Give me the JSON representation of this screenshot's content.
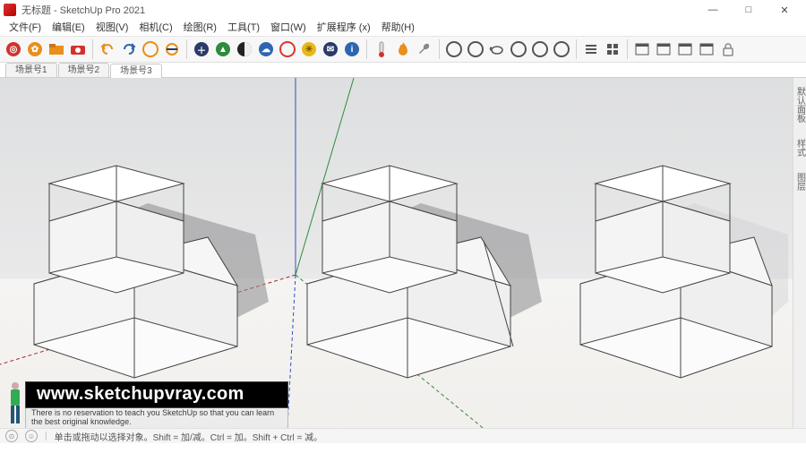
{
  "window": {
    "title": "无标题 - SketchUp Pro 2021",
    "min": "—",
    "max": "□",
    "close": "✕"
  },
  "menu": {
    "file": {
      "full": "文件(F)",
      "u": "F"
    },
    "edit": {
      "full": "编辑(E)",
      "u": "E"
    },
    "view": {
      "full": "视图(V)",
      "u": "V"
    },
    "camera": {
      "full": "相机(C)",
      "u": "C"
    },
    "draw": {
      "full": "绘图(R)",
      "u": "R"
    },
    "tools": {
      "full": "工具(T)",
      "u": "T"
    },
    "window": {
      "full": "窗口(W)",
      "u": "W"
    },
    "ext": {
      "full": "扩展程序 (x)",
      "u": "x"
    },
    "help": {
      "full": "帮助(H)",
      "u": "H"
    }
  },
  "scene_tabs": [
    "场景号1",
    "场景号2",
    "场景号3"
  ],
  "active_scene_index": 2,
  "side_tabs": [
    "默认面板",
    "样式",
    "图层"
  ],
  "watermark": {
    "url": "www.sketchupvray.com",
    "sub": "There is no reservation to teach you SketchUp so that you can learn the best original knowledge."
  },
  "status": {
    "hint": "单击或拖动以选择对象。Shift = 加/减。Ctrl = 加。Shift + Ctrl = 减。"
  },
  "icons": {
    "target": "target-icon",
    "gear": "gear-icon",
    "folder": "folder-icon",
    "camera": "camera-icon",
    "undo": "undo-icon",
    "redo": "redo-icon",
    "ring1": "ring-icon",
    "ringbar": "ring-icon",
    "plus": "plus-icon",
    "tree": "tree-icon",
    "checker": "checker-icon",
    "cloud": "cloud-icon",
    "refresh": "refresh-icon",
    "sun": "sun-icon",
    "mail": "mail-icon",
    "info": "info-icon",
    "thermo": "thermo-icon",
    "flame": "flame-icon",
    "wrench": "wrench-icon",
    "globe": "globe-icon",
    "palette": "palette-icon",
    "teapot": "teapot-icon",
    "spiral": "spiral-icon",
    "swirl": "swirl-icon",
    "rings": "rings-icon",
    "stack": "stack-icon",
    "grid": "grid-icon",
    "win1": "window-icon",
    "win2": "window-icon",
    "win3": "window-icon",
    "win4": "window-icon",
    "lock": "lock-icon"
  },
  "colors": {
    "red": "#d2322d",
    "orange": "#e88f1c",
    "navy": "#2b3a67",
    "green": "#2e8b3d",
    "blue": "#2f65b0",
    "gray": "#777"
  }
}
